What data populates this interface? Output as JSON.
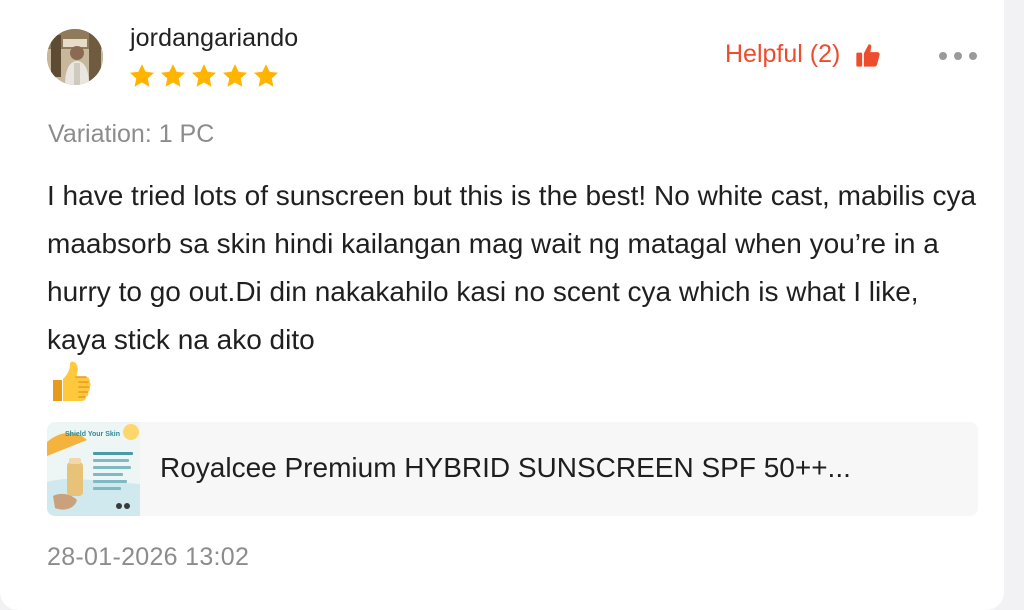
{
  "review": {
    "username": "jordangariando",
    "rating": 5,
    "helpful_label": "Helpful (2)",
    "variation": "Variation: 1 PC",
    "text": "I have tried lots of sunscreen but this is the best! No white cast, mabilis cya maabsorb sa skin hindi kailangan mag wait ng matagal when you’re in a hurry to go out.Di din nakakahilo kasi no scent cya which is what I like, kaya stick na ako dito",
    "timestamp": "28-01-2026 13:02"
  },
  "product": {
    "name": "Royalcee Premium HYBRID SUNSCREEN  SPF 50++...",
    "thumb_caption": "Shield Your Skin"
  },
  "colors": {
    "accent": "#ee4d2d",
    "star": "#ffb400",
    "muted_text": "#8c8c8c"
  },
  "icons": {
    "star": "star-icon",
    "helpful": "thumbs-up-icon",
    "more": "more-icon",
    "emoji": "thumbs-up-emoji"
  }
}
